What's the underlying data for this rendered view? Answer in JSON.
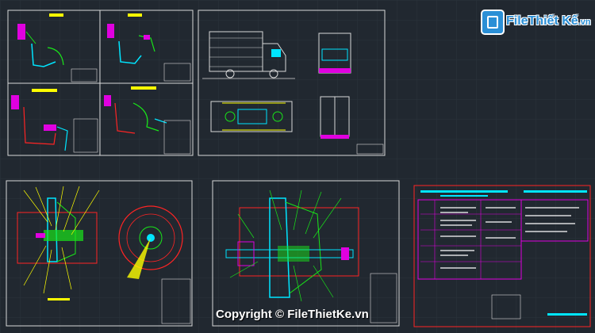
{
  "watermark": {
    "logo_name": "File",
    "logo_rest": "Thiết Kế",
    "logo_domain": ".vn",
    "copyright": "Copyright © FileThietKe.vn"
  },
  "colors": {
    "background": "#212830",
    "grid": "#2b333c",
    "sheet_border": "#d8d8d8",
    "cad_cyan": "#00e5ff",
    "cad_green": "#19e619",
    "cad_magenta": "#e000e0",
    "cad_red": "#ff2424",
    "cad_yellow": "#ffff00",
    "brand_blue": "#2a8fd6"
  },
  "drawings": [
    {
      "id": "pedal-schematics",
      "content": "four-panel-pedal-linkage"
    },
    {
      "id": "truck-views",
      "content": "truck-side-front-top-rear"
    },
    {
      "id": "servo-section-left",
      "content": "booster-section-and-diaphragm"
    },
    {
      "id": "servo-section-right",
      "content": "booster-assembly-section"
    },
    {
      "id": "title-table",
      "content": "specification-table"
    }
  ]
}
